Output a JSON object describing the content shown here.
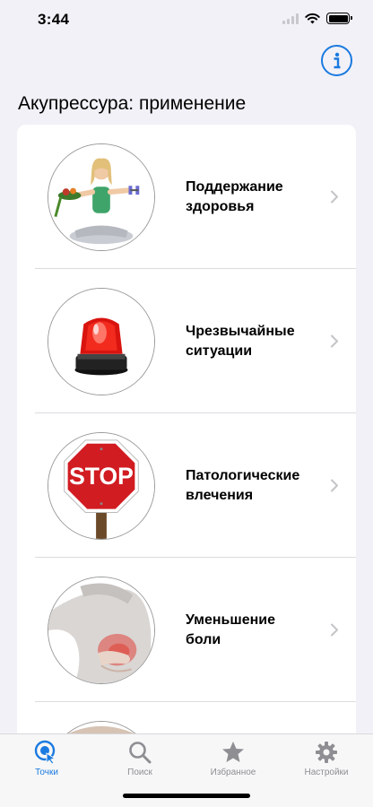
{
  "status_bar": {
    "time": "3:44"
  },
  "header": {
    "title": "Акупрессура: применение",
    "info_icon": "info-circle-icon"
  },
  "list": {
    "items": [
      {
        "label": "Поддержание\nздоровья",
        "image": "yoga-woman-with-vegetables-and-dumbbells"
      },
      {
        "label": "Чрезвычайные\nситуации",
        "image": "red-emergency-siren-light"
      },
      {
        "label": "Патологические\nвлечения",
        "image": "stop-sign"
      },
      {
        "label": "Уменьшение\nболи",
        "image": "back-pain-highlighted"
      }
    ]
  },
  "tab_bar": {
    "tabs": [
      {
        "label": "Точки",
        "icon": "touch-point-icon",
        "active": true
      },
      {
        "label": "Поиск",
        "icon": "search-icon",
        "active": false
      },
      {
        "label": "Избранное",
        "icon": "star-icon",
        "active": false
      },
      {
        "label": "Настройки",
        "icon": "gear-icon",
        "active": false
      }
    ]
  },
  "colors": {
    "accent": "#1a7ae0",
    "background": "#f2f1f7",
    "inactive_tab": "#8e8e93"
  }
}
